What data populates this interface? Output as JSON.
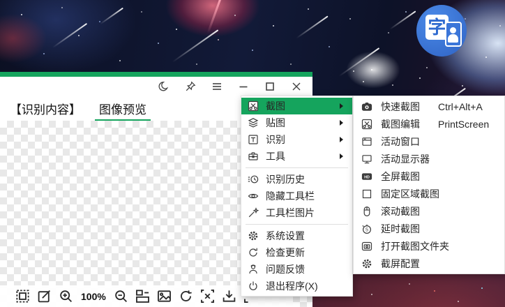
{
  "colors": {
    "accent_green": "#15a45d",
    "app_icon_blue": "#3b76d9"
  },
  "app": {
    "icon_char": "字"
  },
  "window": {
    "titlebar": {
      "buttons": [
        "dark-mode",
        "pin",
        "hamburger-menu",
        "minimize",
        "maximize",
        "close"
      ]
    },
    "tabs": [
      {
        "label": "【识别内容】",
        "active": false
      },
      {
        "label": "图像预览",
        "active": true
      }
    ],
    "toolbar": {
      "zoom_level": "100%",
      "items": [
        "stamp",
        "edit",
        "zoom-in",
        "zoom-level",
        "zoom-out",
        "layout",
        "image",
        "rotate",
        "crop-x",
        "download",
        "expand"
      ]
    }
  },
  "menu": {
    "items": [
      {
        "id": "screenshot",
        "label": "截图",
        "icon": "scissors-box",
        "submenu": true,
        "highlighted": true
      },
      {
        "id": "paste-image",
        "label": "贴图",
        "icon": "layers",
        "submenu": true
      },
      {
        "id": "recognize",
        "label": "识别",
        "icon": "text-box",
        "submenu": true
      },
      {
        "id": "tools",
        "label": "工具",
        "icon": "toolbox",
        "submenu": true
      },
      {
        "separator": true
      },
      {
        "id": "recognition-history",
        "label": "识别历史",
        "icon": "history"
      },
      {
        "id": "hide-toolbar",
        "label": "隐藏工具栏",
        "icon": "eye"
      },
      {
        "id": "toolbar-image",
        "label": "工具栏图片",
        "icon": "magic-wand"
      },
      {
        "separator": true
      },
      {
        "id": "system-settings",
        "label": "系统设置",
        "icon": "gear"
      },
      {
        "id": "check-update",
        "label": "检查更新",
        "icon": "refresh"
      },
      {
        "id": "feedback",
        "label": "问题反馈",
        "icon": "feedback-person"
      },
      {
        "id": "exit",
        "label": "退出程序(X)",
        "icon": "power"
      }
    ]
  },
  "submenu": {
    "items": [
      {
        "id": "quick-screenshot",
        "label": "快速截图",
        "shortcut": "Ctrl+Alt+A",
        "icon": "camera"
      },
      {
        "id": "screenshot-edit",
        "label": "截图编辑",
        "shortcut": "PrintScreen",
        "icon": "scissors-box"
      },
      {
        "id": "active-window",
        "label": "活动窗口",
        "icon": "app-window"
      },
      {
        "id": "active-display",
        "label": "活动显示器",
        "icon": "monitor"
      },
      {
        "id": "fullscreen-screenshot",
        "label": "全屏截图",
        "icon": "hd-screen"
      },
      {
        "id": "fixed-region-screenshot",
        "label": "固定区域截图",
        "icon": "square"
      },
      {
        "id": "scrolling-screenshot",
        "label": "滚动截图",
        "icon": "mouse"
      },
      {
        "id": "delayed-screenshot",
        "label": "延时截图",
        "icon": "timer"
      },
      {
        "id": "open-screenshot-folder",
        "label": "打开截图文件夹",
        "icon": "folder-image"
      },
      {
        "id": "screenshot-config",
        "label": "截屏配置",
        "icon": "gear"
      }
    ]
  }
}
